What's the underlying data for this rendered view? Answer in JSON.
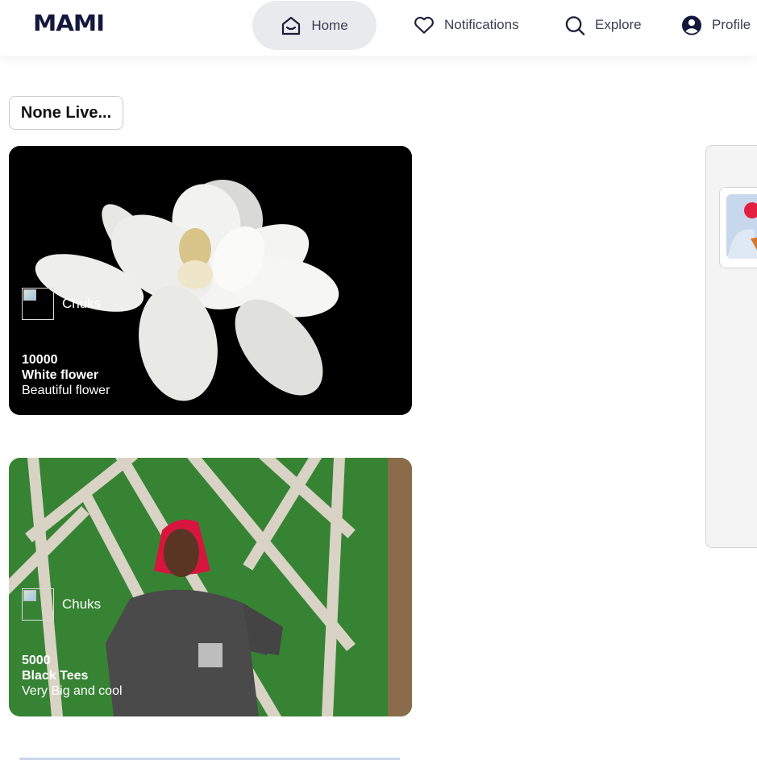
{
  "app": {
    "logo": "MAMI"
  },
  "nav": {
    "home": "Home",
    "notifications": "Notifications",
    "explore": "Explore",
    "profile": "Profile"
  },
  "live": {
    "label": "None Live..."
  },
  "posts": [
    {
      "author": "Chuks",
      "price": "10000",
      "title": "White flower",
      "description": "Beautiful flower"
    },
    {
      "author": "Chuks",
      "price": "5000",
      "title": "Black Tees",
      "description": "Very Big and cool"
    }
  ],
  "colors": {
    "brand": "#14183d",
    "nav_active_bg": "#e9eaee",
    "panel_bg": "#f4f4f5"
  }
}
